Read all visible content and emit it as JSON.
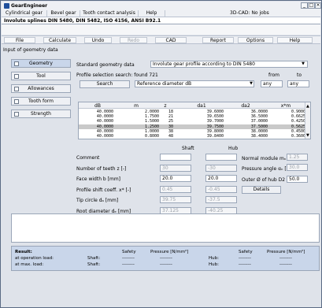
{
  "app": {
    "name": "GearEngineer"
  },
  "window_buttons": [
    "_",
    "□",
    "×"
  ],
  "menu": [
    {
      "label": "Cylindrical gear"
    },
    {
      "label": "Bevel gear"
    },
    {
      "label": "Tooth contact analysis"
    },
    {
      "label": "Help"
    },
    {
      "label": "3D-CAD: No jobs"
    }
  ],
  "document": {
    "title": "Involute splines DIN 5480, DIN 5482, ISO 4156, ANSI B92.1"
  },
  "toolbar": [
    {
      "label": "File",
      "disabled": false
    },
    {
      "label": "Calculate",
      "disabled": false
    },
    {
      "label": "Undo",
      "disabled": false
    },
    {
      "label": "Redo",
      "disabled": true
    },
    {
      "label": "CAD",
      "disabled": false
    },
    {
      "label": "Report",
      "disabled": false
    },
    {
      "label": "Options",
      "disabled": false
    },
    {
      "label": "Help",
      "disabled": false
    }
  ],
  "section_label": "Input of geometry data",
  "nav": [
    {
      "label": "Geometry",
      "active": true
    },
    {
      "label": "Tool",
      "active": false
    },
    {
      "label": "Allowances",
      "active": false
    },
    {
      "label": "Tooth form",
      "active": false
    },
    {
      "label": "Strength",
      "active": false
    }
  ],
  "standard": {
    "label": "Standard geometry data",
    "value": "Involute gear profile according to DIN 5480"
  },
  "profile_search": {
    "label": "Profile selection search: found 721",
    "from": "from",
    "to": "to",
    "button": "Search",
    "select_value": "Reference diameter dB",
    "from_value": "any",
    "to_value": "any"
  },
  "table": {
    "columns": [
      "dB",
      "m",
      "z",
      "da1",
      "da2",
      "x*m"
    ],
    "rows": [
      [
        "40.0000",
        "2.0000",
        "18",
        "39.6000",
        "36.0000",
        "0.9000"
      ],
      [
        "40.0000",
        "1.7500",
        "21",
        "39.6500",
        "36.5000",
        "0.6625"
      ],
      [
        "40.0000",
        "1.5000",
        "25",
        "39.7000",
        "37.0000",
        "0.4250"
      ],
      [
        "40.0000",
        "1.2500",
        "30",
        "39.7500",
        "37.5000",
        "0.5625"
      ],
      [
        "40.0000",
        "1.0000",
        "38",
        "39.8000",
        "38.0000",
        "0.4500"
      ],
      [
        "40.0000",
        "0.8000",
        "48",
        "39.8400",
        "38.4000",
        "0.3600"
      ]
    ],
    "selected_row": 3
  },
  "form": {
    "shaft_header": "Shaft",
    "hub_header": "Hub",
    "rows": [
      {
        "label": "Comment",
        "shaft": "",
        "hub": "",
        "shaft_dis": false,
        "hub_dis": false
      },
      {
        "label": "Number of teeth z [-]",
        "shaft": "30",
        "hub": "-30",
        "shaft_dis": true,
        "hub_dis": true
      },
      {
        "label": "Face width b [mm]",
        "shaft": "20.0",
        "hub": "20.0",
        "shaft_dis": false,
        "hub_dis": false
      },
      {
        "label": "Profile shift coeff. x* [-]",
        "shaft": "0.45",
        "hub": "-0.45",
        "shaft_dis": true,
        "hub_dis": true
      },
      {
        "label": "Tip circle dₐ [mm]",
        "shaft": "39.75",
        "hub": "-37.5",
        "shaft_dis": true,
        "hub_dis": true
      },
      {
        "label": "Root diameter dₑ [mm]",
        "shaft": "37.125",
        "hub": "-40.25",
        "shaft_dis": true,
        "hub_dis": true
      }
    ],
    "normal_module": {
      "label": "Normal module mₙ [mm]",
      "value": "1.25"
    },
    "pressure_angle": {
      "label": "Pressure angle αₙ [°]",
      "value": "30.0"
    },
    "outer_hub": {
      "label": "Outer Ø of hub D2 [mm]",
      "value": "50.0"
    },
    "details_button": "Details"
  },
  "results": {
    "title": "Result:",
    "safety": "Safety",
    "pressure": "Pressure [N/mm²]",
    "rows": [
      {
        "label": "at operation load:",
        "shaft": "Shaft:",
        "v1": "--------",
        "v2": "--------",
        "hub": "Hub:",
        "v3": "--------",
        "v4": "--------"
      },
      {
        "label": "at max. load:",
        "shaft": "Shaft:",
        "v1": "--------",
        "v2": "--------",
        "hub": "Hub:",
        "v3": "--------",
        "v4": "--------"
      }
    ]
  }
}
